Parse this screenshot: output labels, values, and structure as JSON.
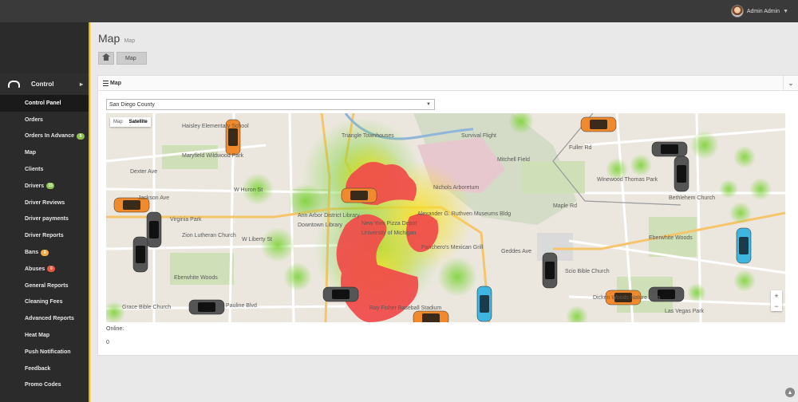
{
  "header": {
    "user_name": "Admin Admin"
  },
  "sidebar": {
    "section_label": "Control",
    "items": [
      {
        "label": "Control Panel",
        "active": true
      },
      {
        "label": "Orders"
      },
      {
        "label": "Orders In Advance",
        "badge": "0",
        "badge_color": "#8cc152"
      },
      {
        "label": "Map"
      },
      {
        "label": "Clients"
      },
      {
        "label": "Drivers",
        "badge": "15",
        "badge_color": "#8cc152"
      },
      {
        "label": "Driver Reviews"
      },
      {
        "label": "Driver payments"
      },
      {
        "label": "Driver Reports"
      },
      {
        "label": "Bans",
        "badge": "0",
        "badge_color": "#f0ad4e"
      },
      {
        "label": "Abuses",
        "badge": "0",
        "badge_color": "#e9573f"
      },
      {
        "label": "General Reports"
      },
      {
        "label": "Cleaning Fees"
      },
      {
        "label": "Advanced Reports"
      },
      {
        "label": "Heat Map"
      },
      {
        "label": "Push Notification"
      },
      {
        "label": "Feedback"
      },
      {
        "label": "Promo Codes"
      }
    ]
  },
  "page": {
    "title": "Map",
    "subtitle": "Map",
    "breadcrumb": [
      "Map"
    ]
  },
  "panel": {
    "title": "Map",
    "county_select": "San Diego County",
    "map_type_options": [
      "Map",
      "Satellite"
    ],
    "zoom_in": "+",
    "zoom_out": "−",
    "online_label": "Online:",
    "online_count": "0"
  },
  "map_labels": [
    "Haisley Elementary School",
    "Maryfield Wildwood Park",
    "Dexter Ave",
    "Jackson Ave",
    "W Huron St",
    "Virginia Park",
    "Zion Lutheran Church",
    "W Liberty St",
    "Pauline Blvd",
    "Grace Bible Church",
    "Eberwhite Woods",
    "Triangle Townhouses",
    "Ann Arbor District Library",
    "Downtown Library",
    "New York Pizza Depot",
    "University of Michigan",
    "Alexander G. Ruthven Museums Bldg",
    "Panchero's Mexican Grill",
    "Nichols Arboretum",
    "Survival Flight",
    "Mitchell Field",
    "Winewood Thomas Park",
    "Bethlehem Church",
    "Eberwhite Woods",
    "Scio Bible Church",
    "Dicken Woods Nature Area",
    "Las Vegas Park",
    "Ray Fisher Baseball Stadium",
    "Maple Rd",
    "Fuller Rd",
    "Geddes Ave"
  ]
}
